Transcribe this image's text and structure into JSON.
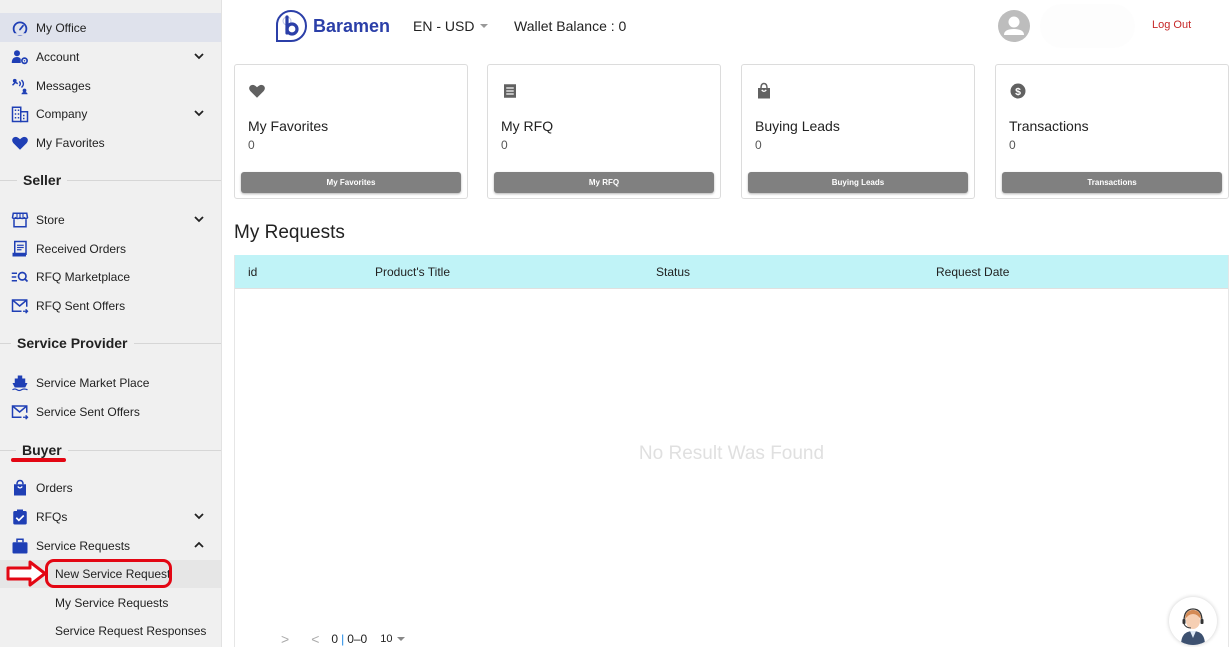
{
  "sidebar": {
    "top_items": [
      {
        "label": "My Office",
        "icon": "gauge-icon",
        "active": true
      },
      {
        "label": "Account",
        "icon": "user-gear-icon",
        "expandable": true
      },
      {
        "label": "Messages",
        "icon": "messages-icon"
      },
      {
        "label": "Company",
        "icon": "building-icon",
        "expandable": true
      },
      {
        "label": "My Favorites",
        "icon": "heart-icon"
      }
    ],
    "seller": {
      "heading": "Seller",
      "items": [
        {
          "label": "Store",
          "icon": "store-icon",
          "expandable": true
        },
        {
          "label": "Received Orders",
          "icon": "receipt-icon"
        },
        {
          "label": "RFQ Marketplace",
          "icon": "list-search-icon"
        },
        {
          "label": "RFQ Sent Offers",
          "icon": "mail-send-icon"
        }
      ]
    },
    "service_provider": {
      "heading": "Service Provider",
      "items": [
        {
          "label": "Service Market Place",
          "icon": "ship-icon"
        },
        {
          "label": "Service Sent Offers",
          "icon": "mail-send-icon"
        }
      ]
    },
    "buyer": {
      "heading": "Buyer",
      "items": [
        {
          "label": "Orders",
          "icon": "bag-icon"
        },
        {
          "label": "RFQs",
          "icon": "clipboard-check-icon",
          "expandable": true
        },
        {
          "label": "Service Requests",
          "icon": "briefcase-icon",
          "expanded": true
        }
      ],
      "sub_items": [
        {
          "label": "New Service Request",
          "active": true
        },
        {
          "label": "My Service Requests"
        },
        {
          "label": "Service Request Responses"
        }
      ]
    }
  },
  "header": {
    "brand": "Baramen",
    "language_currency": "EN - USD",
    "wallet_balance": "Wallet Balance : 0",
    "logout": "Log Out"
  },
  "cards": [
    {
      "title": "My Favorites",
      "value": "0",
      "button": "My Favorites",
      "icon": "heart-icon"
    },
    {
      "title": "My RFQ",
      "value": "0",
      "button": "My RFQ",
      "icon": "document-list-icon"
    },
    {
      "title": "Buying Leads",
      "value": "0",
      "button": "Buying Leads",
      "icon": "shopping-bag-icon"
    },
    {
      "title": "Transactions",
      "value": "0",
      "button": "Transactions",
      "icon": "dollar-circle-icon"
    }
  ],
  "requests": {
    "title": "My Requests",
    "columns": [
      "id",
      "Product's Title",
      "Status",
      "Request Date"
    ],
    "rows": [],
    "empty_message": "No Result Was Found",
    "pagination": {
      "prev": ">",
      "next": "<",
      "page": "0",
      "range": "0–0",
      "per_page": "10"
    }
  },
  "colors": {
    "brand": "#2b3fa8",
    "nav_icon": "#1f3fb5",
    "table_header": "#c0f3f7",
    "logout": "#c62828",
    "annotation": "#e30613"
  }
}
